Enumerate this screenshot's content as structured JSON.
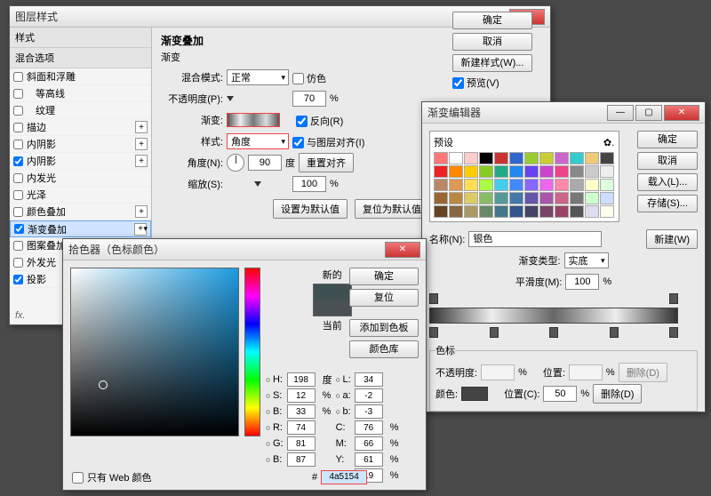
{
  "layerStyle": {
    "title": "图层样式",
    "buttons": {
      "ok": "确定",
      "cancel": "取消",
      "newStyle": "新建样式(W)...",
      "preview": "预览(V)",
      "makeDefault": "设置为默认值",
      "resetDefault": "复位为默认值"
    },
    "listHeaders": {
      "styles": "样式",
      "blend": "混合选项"
    },
    "styles": [
      {
        "label": "斜面和浮雕",
        "checked": false,
        "plus": false
      },
      {
        "label": "等高线",
        "checked": false,
        "plus": false,
        "indent": true
      },
      {
        "label": "纹理",
        "checked": false,
        "plus": false,
        "indent": true
      },
      {
        "label": "描边",
        "checked": false,
        "plus": true
      },
      {
        "label": "内阴影",
        "checked": false,
        "plus": true
      },
      {
        "label": "内阴影",
        "checked": true,
        "plus": true
      },
      {
        "label": "内发光",
        "checked": false,
        "plus": false
      },
      {
        "label": "光泽",
        "checked": false,
        "plus": false
      },
      {
        "label": "颜色叠加",
        "checked": false,
        "plus": true
      },
      {
        "label": "渐变叠加",
        "checked": true,
        "plus": true,
        "selected": true
      },
      {
        "label": "图案叠加",
        "checked": false,
        "plus": false
      },
      {
        "label": "外发光",
        "checked": false,
        "plus": false
      },
      {
        "label": "投影",
        "checked": true,
        "plus": true
      }
    ],
    "groupTitle": "渐变叠加",
    "subTitle": "渐变",
    "fields": {
      "blendModeLabel": "混合模式:",
      "blendMode": "正常",
      "dither": "仿色",
      "opacityLabel": "不透明度(P):",
      "opacity": "70",
      "pct": "%",
      "gradientLabel": "渐变:",
      "reverse": "反向(R)",
      "styleLabel": "样式:",
      "styleVal": "角度",
      "alignLayer": "与图层对齐(I)",
      "angleLabel": "角度(N):",
      "angle": "90",
      "deg": "度",
      "resetAlign": "重置对齐",
      "scaleLabel": "缩放(S):",
      "scale": "100"
    }
  },
  "gradEditor": {
    "title": "渐变编辑器",
    "buttons": {
      "ok": "确定",
      "cancel": "取消",
      "load": "载入(L)...",
      "save": "存储(S)...",
      "new": "新建(W)",
      "delete": "删除(D)"
    },
    "presetsLabel": "预设",
    "nameLabel": "名称(N):",
    "name": "银色",
    "typeLabel": "渐变类型:",
    "type": "实底",
    "smoothLabel": "平滑度(M):",
    "smooth": "100",
    "pct": "%",
    "stopsLabel": "色标",
    "opacityLabel": "不透明度:",
    "posLabel": "位置:",
    "pos2Label": "位置(C):",
    "pos2": "50",
    "colorLabel": "颜色:",
    "presetColors": [
      "#f77",
      "#fff",
      "#fcc",
      "#000",
      "#c33",
      "#36c",
      "#9c3",
      "#cc3",
      "#c6c",
      "#3cc",
      "#ec7",
      "#444",
      "#e22",
      "#f80",
      "#fc0",
      "#8c2",
      "#2a8",
      "#28e",
      "#64e",
      "#c4c",
      "#e48",
      "#888",
      "#ccc",
      "#eee",
      "#b86",
      "#d95",
      "#fd5",
      "#af4",
      "#4ce",
      "#48f",
      "#86f",
      "#e6e",
      "#f8a",
      "#aaa",
      "#ffc",
      "#dfd",
      "#963",
      "#b84",
      "#dc6",
      "#8b6",
      "#599",
      "#47a",
      "#65a",
      "#a5a",
      "#c68",
      "#777",
      "#cfc",
      "#cdf",
      "#642",
      "#864",
      "#a96",
      "#686",
      "#478",
      "#358",
      "#446",
      "#746",
      "#946",
      "#555",
      "#dde",
      "#ffe"
    ]
  },
  "colorPicker": {
    "title": "拾色器（色标颜色）",
    "buttons": {
      "ok": "确定",
      "cancel": "复位",
      "add": "添加到色板",
      "lib": "颜色库"
    },
    "labels": {
      "new": "新的",
      "current": "当前",
      "onlyWeb": "只有 Web 颜色",
      "hex": "#"
    },
    "vals": {
      "H": "198",
      "Hd": "度",
      "S": "12",
      "Su": "%",
      "B": "33",
      "Bu": "%",
      "R": "74",
      "G": "81",
      "Bl": "87",
      "L": "34",
      "a": "-2",
      "b": "-3",
      "C": "76",
      "Cu": "%",
      "M": "66",
      "Mu": "%",
      "Y": "61",
      "Yu": "%",
      "K": "19",
      "Ku": "%",
      "hex": "4a5154"
    }
  }
}
